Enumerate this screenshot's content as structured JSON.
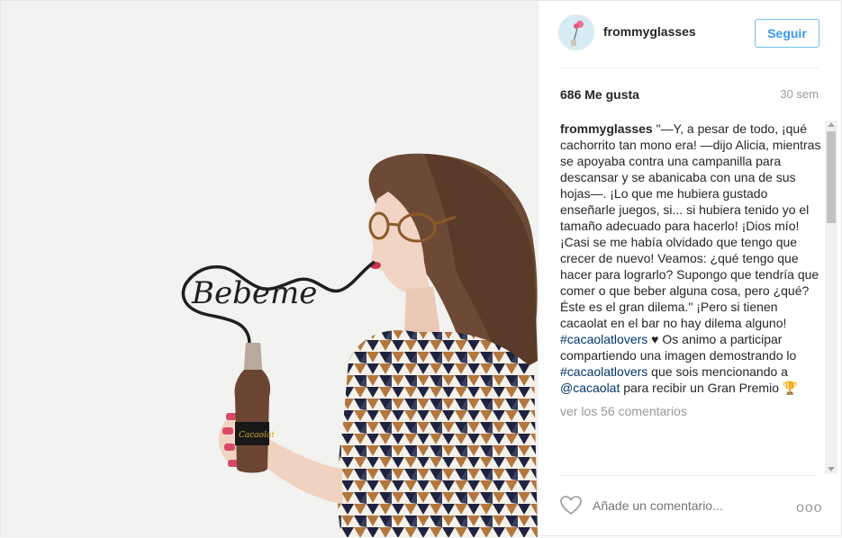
{
  "post": {
    "username": "frommyglasses",
    "follow_label": "Seguir",
    "likes": "686 Me gusta",
    "time_ago": "30 sem"
  },
  "caption": {
    "author": "frommyglasses",
    "text1": "\"—Y, a pesar de todo, ¡qué cachorrito tan mono era! —dijo Alicia, mientras se apoyaba contra una campanilla para descansar y se abanicaba con una de sus hojas—. ¡Lo que me hubiera gustado enseñarle juegos, si... si hubiera tenido yo el tamaño adecuado para hacerlo! ¡Dios mío! ¡Casi se me había olvidado que tengo que crecer de nuevo! Veamos: ¿qué tengo que hacer para lograrlo? Supongo que tendría que comer o que beber alguna cosa, pero ¿qué? Éste es el gran dilema.\" ¡Pero si tienen cacaolat en el bar no hay dilema alguno!",
    "hashtag1": "#cacaolatlovers",
    "emoji1": "♥",
    "text2": "Os animo a participar compartiendo una imagen demostrando lo",
    "hashtag2": "#cacaolatlovers",
    "text3": "que sois mencionando a",
    "mention": "@cacaolat",
    "text4": "para recibir un Gran Premio",
    "emoji2": "🏆",
    "view_comments": "ver los 56 comentarios"
  },
  "footer": {
    "comment_placeholder": "Añade un comentario...",
    "more_label": "ooo"
  },
  "photo": {
    "straw_text": "Bebeme",
    "bottle_label": "Cacaolat"
  },
  "colors": {
    "follow_blue": "#3897f0",
    "link_blue": "#003569"
  }
}
